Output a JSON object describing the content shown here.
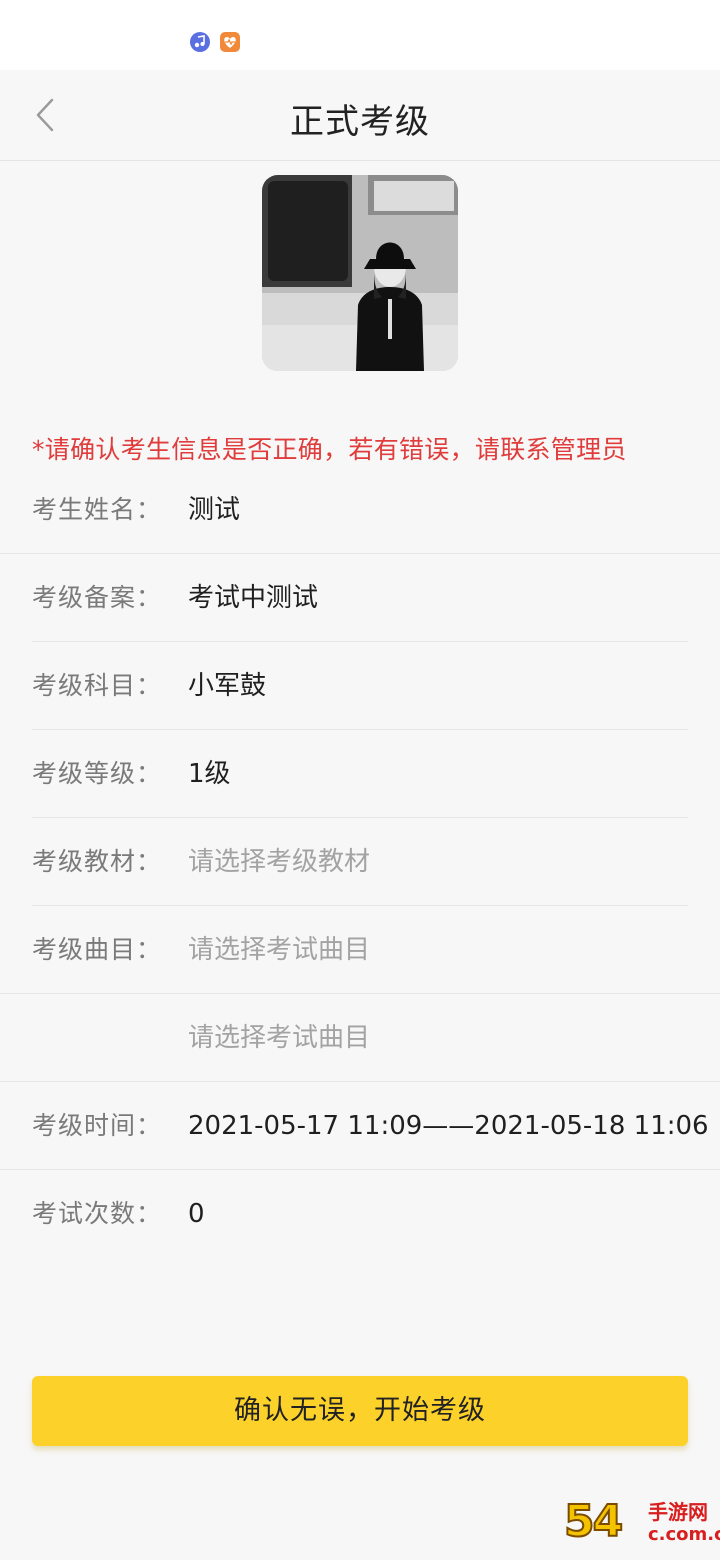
{
  "header": {
    "title": "正式考级"
  },
  "notice": "*请确认考生信息是否正确，若有错误，请联系管理员",
  "fields": [
    {
      "label": "考生姓名：",
      "value": "测试",
      "placeholder": false
    },
    {
      "label": "考级备案：",
      "value": "考试中测试",
      "placeholder": false
    },
    {
      "label": "考级科目：",
      "value": "小军鼓",
      "placeholder": false
    },
    {
      "label": "考级等级：",
      "value": "1级",
      "placeholder": false
    },
    {
      "label": "考级教材：",
      "value": "请选择考级教材",
      "placeholder": true
    },
    {
      "label": "考级曲目：",
      "value": "请选择考试曲目",
      "placeholder": true
    },
    {
      "label": "",
      "value": "请选择考试曲目",
      "placeholder": true
    },
    {
      "label": "考级时间：",
      "value": "2021-05-17 11:09——2021-05-18 11:06",
      "placeholder": false
    },
    {
      "label": "考试次数：",
      "value": "0",
      "placeholder": false
    }
  ],
  "confirm_button": {
    "label": "确认无误，开始考级"
  },
  "watermark": {
    "number": "54",
    "brand": "手游网",
    "domain": "c.com.cn"
  },
  "colors": {
    "accent": "#fcd22a",
    "notice": "#e03c3c"
  }
}
